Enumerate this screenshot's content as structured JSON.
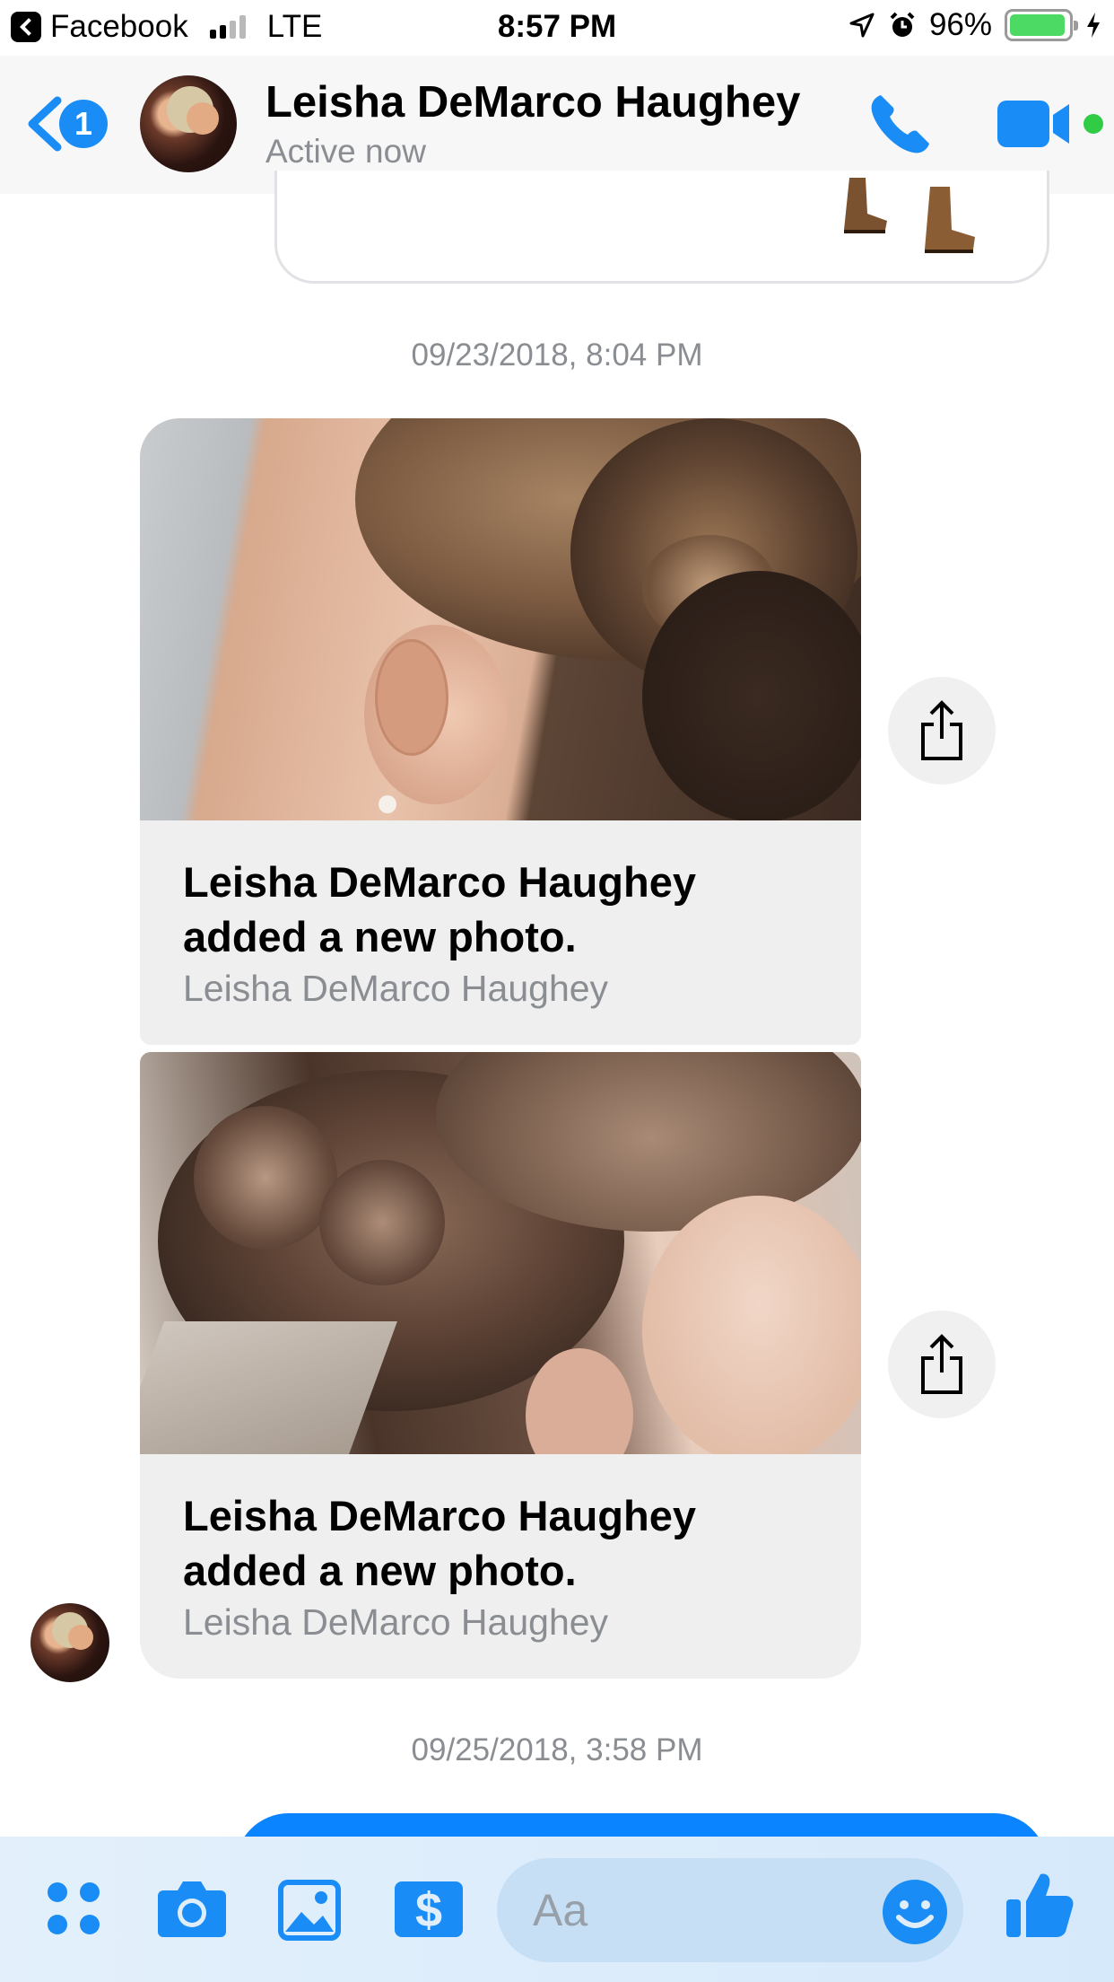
{
  "status_bar": {
    "back_app": "Facebook",
    "network": "LTE",
    "time": "8:57 PM",
    "battery_percent": "96%",
    "battery_level": 0.96
  },
  "header": {
    "contact_name": "Leisha DeMarco Haughey",
    "contact_status": "Active now",
    "unread_count": "1",
    "accent_color": "#1a8cf6"
  },
  "conversation": {
    "timestamp_1": "09/23/2018, 8:04 PM",
    "cards": [
      {
        "title": "Leisha DeMarco Haughey added a new photo.",
        "source": "Leisha DeMarco Haughey"
      },
      {
        "title": "Leisha DeMarco Haughey added a new photo.",
        "source": "Leisha DeMarco Haughey"
      }
    ],
    "timestamp_2": "09/25/2018, 3:58 PM"
  },
  "composer": {
    "placeholder": "Aa",
    "icons": [
      "more-apps-icon",
      "camera-icon",
      "gallery-icon",
      "payment-icon",
      "emoji-icon",
      "thumbs-up-icon"
    ]
  }
}
